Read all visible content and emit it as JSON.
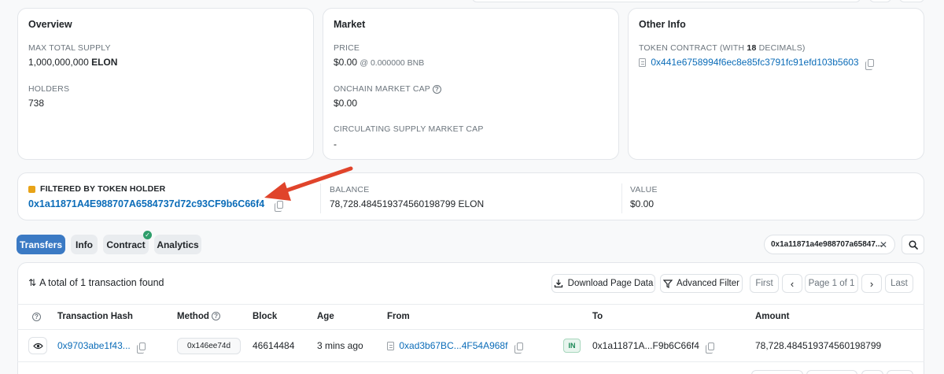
{
  "overview": {
    "title": "Overview",
    "max_supply_label": "MAX TOTAL SUPPLY",
    "max_supply_value": "1,000,000,000",
    "max_supply_symbol": "ELON",
    "holders_label": "HOLDERS",
    "holders_value": "738"
  },
  "market": {
    "title": "Market",
    "price_label": "PRICE",
    "price_value": "$0.00",
    "price_bnb": "@ 0.000000 BNB",
    "onchain_cap_label": "ONCHAIN MARKET CAP",
    "onchain_cap_value": "$0.00",
    "circ_cap_label": "CIRCULATING SUPPLY MARKET CAP",
    "circ_cap_value": "-"
  },
  "other_info": {
    "title": "Other Info",
    "contract_label_pre": "TOKEN CONTRACT (WITH ",
    "contract_decimals": "18",
    "contract_label_post": " DECIMALS)",
    "contract_address": "0x441e6758994f6ec8e85fc3791fc91efd103b5603"
  },
  "holder_filter": {
    "label": "FILTERED BY TOKEN HOLDER",
    "address": "0x1a11871A4E988707A6584737d72c93CF9b6C66f4",
    "balance_label": "BALANCE",
    "balance_value": "78,728.484519374560198799 ELON",
    "value_label": "VALUE",
    "value_value": "$0.00"
  },
  "tabs": [
    {
      "label": "Transfers",
      "active": true
    },
    {
      "label": "Info",
      "active": false
    },
    {
      "label": "Contract",
      "active": false,
      "verified": true
    },
    {
      "label": "Analytics",
      "active": false
    }
  ],
  "filter_chip": "0x1a11871a4e988707a65847...",
  "table_toolbar": {
    "summary": "A total of 1 transaction found",
    "download": "Download Page Data",
    "advanced_filter": "Advanced Filter",
    "first": "First",
    "page": "Page 1 of 1",
    "last": "Last"
  },
  "table": {
    "headers": {
      "hash": "Transaction Hash",
      "method": "Method",
      "block": "Block",
      "age": "Age",
      "from": "From",
      "to": "To",
      "amount": "Amount"
    },
    "rows": [
      {
        "hash": "0x9703abe1f43...",
        "method": "0x146ee74d",
        "block": "46614484",
        "age": "3 mins ago",
        "from": "0xad3b67BC...4F54A968f",
        "direction": "IN",
        "to": "0x1a11871A...F9b6C66f4",
        "amount": "78,728.484519374560198799"
      }
    ]
  },
  "colors": {
    "link": "#0b6cb8",
    "active_tab": "#3b7ac4",
    "arrow": "#e0442b",
    "in_badge": "#198754",
    "verified": "#2e9e6b"
  }
}
